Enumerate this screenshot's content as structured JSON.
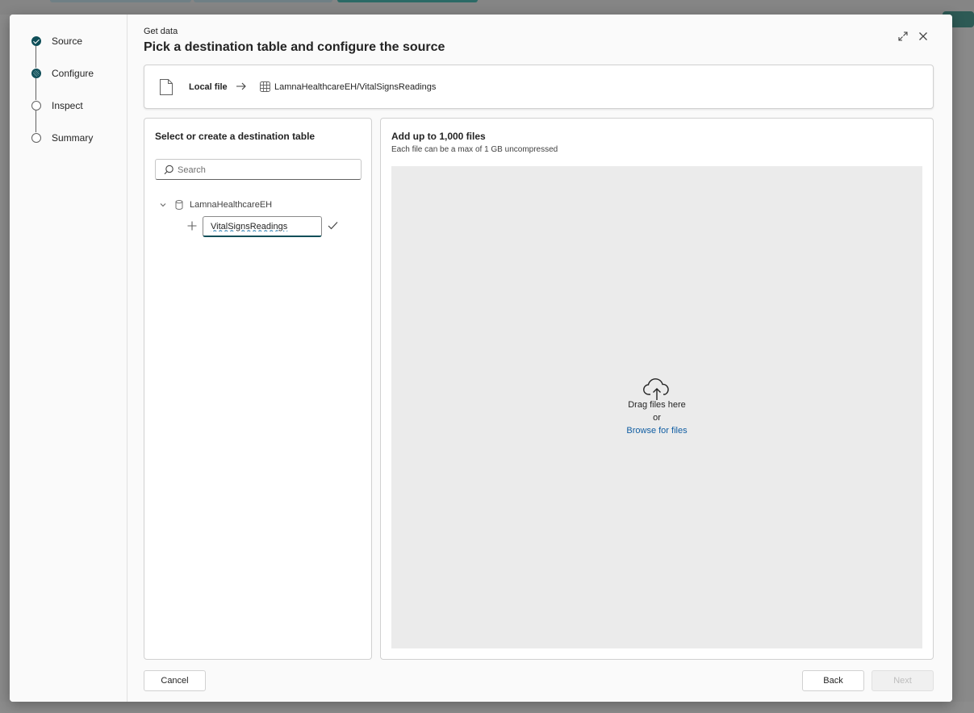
{
  "stepper": {
    "steps": [
      {
        "label": "Source",
        "state": "done"
      },
      {
        "label": "Configure",
        "state": "current"
      },
      {
        "label": "Inspect",
        "state": "pending"
      },
      {
        "label": "Summary",
        "state": "pending"
      }
    ]
  },
  "header": {
    "subtitle": "Get data",
    "title": "Pick a destination table and configure the source",
    "icons": [
      "expand-icon",
      "close-icon"
    ]
  },
  "breadcrumb": {
    "source": "Local file",
    "destination": "LamnaHealthcareEH/VitalSignsReadings"
  },
  "destination_panel": {
    "title": "Select or create a destination table",
    "search_placeholder": "Search",
    "database": "LamnaHealthcareEH",
    "new_table_value": "VitalSignsReadings"
  },
  "files_panel": {
    "title": "Add up to 1,000 files",
    "subtitle": "Each file can be a max of 1 GB uncompressed",
    "drag_text": "Drag files here",
    "or_text": "or",
    "browse_text": "Browse for files"
  },
  "footer": {
    "cancel": "Cancel",
    "back": "Back",
    "next": "Next"
  },
  "colors": {
    "accent": "#0f4e58",
    "link": "#115ea3"
  }
}
